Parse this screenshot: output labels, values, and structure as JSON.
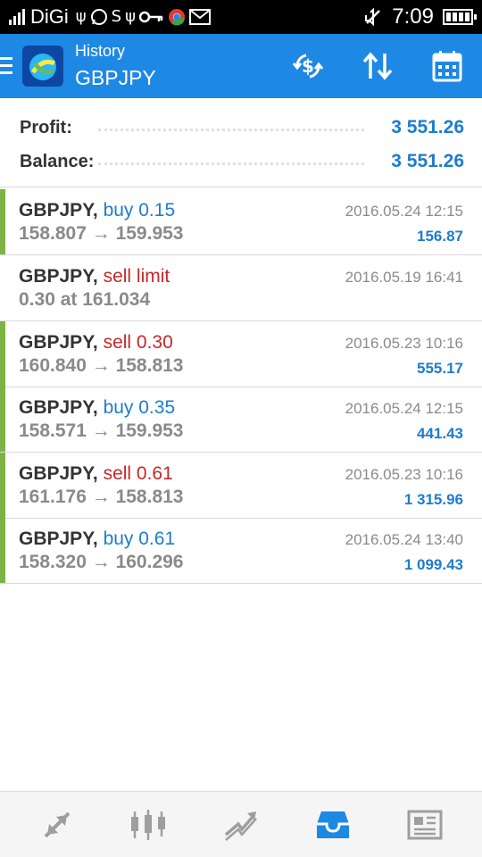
{
  "status_bar": {
    "carrier": "DiGi",
    "time": "7:09",
    "icons": [
      "signal-icon",
      "usb-icon",
      "whatsapp-icon",
      "sync-icon",
      "usb-icon",
      "key-icon",
      "chrome-icon",
      "gmail-icon",
      "mute-icon",
      "battery-icon"
    ]
  },
  "header": {
    "title": "History",
    "subtitle": "GBPJPY",
    "buttons": [
      "currency-exchange-icon",
      "sort-icon",
      "calendar-icon"
    ]
  },
  "summary": {
    "profit_label": "Profit:",
    "profit_value": "3 551.26",
    "balance_label": "Balance:",
    "balance_value": "3 551.26"
  },
  "deals": [
    {
      "symbol": "GBPJPY",
      "sep": ",",
      "type": "buy 0.15",
      "side": "buy",
      "prices": "158.807 → 159.953",
      "date": "2016.05.24 12:15",
      "profit": "156.87",
      "bar": true
    },
    {
      "symbol": "GBPJPY",
      "sep": ",",
      "type": "sell limit",
      "side": "sell",
      "prices": "0.30 at 161.034",
      "date": "2016.05.19 16:41",
      "profit": "",
      "bar": false
    },
    {
      "symbol": "GBPJPY",
      "sep": ",",
      "type": "sell 0.30",
      "side": "sell",
      "prices": "160.840 → 158.813",
      "date": "2016.05.23 10:16",
      "profit": "555.17",
      "bar": true
    },
    {
      "symbol": "GBPJPY",
      "sep": ",",
      "type": "buy 0.35",
      "side": "buy",
      "prices": "158.571 → 159.953",
      "date": "2016.05.24 12:15",
      "profit": "441.43",
      "bar": true
    },
    {
      "symbol": "GBPJPY",
      "sep": ",",
      "type": "sell 0.61",
      "side": "sell",
      "prices": "161.176 → 158.813",
      "date": "2016.05.23 10:16",
      "profit": "1 315.96",
      "bar": true
    },
    {
      "symbol": "GBPJPY",
      "sep": ",",
      "type": "buy 0.61",
      "side": "buy",
      "prices": "158.320 → 160.296",
      "date": "2016.05.24 13:40",
      "profit": "1 099.43",
      "bar": true
    }
  ],
  "bottom_nav": {
    "items": [
      "quotes-icon",
      "chart-icon",
      "trade-icon",
      "history-icon",
      "news-icon"
    ],
    "active": "history-icon"
  },
  "colors": {
    "accent": "#1e88e5",
    "buy": "#1e7bd1",
    "sell": "#c62828",
    "position_bar": "#7cb342"
  }
}
